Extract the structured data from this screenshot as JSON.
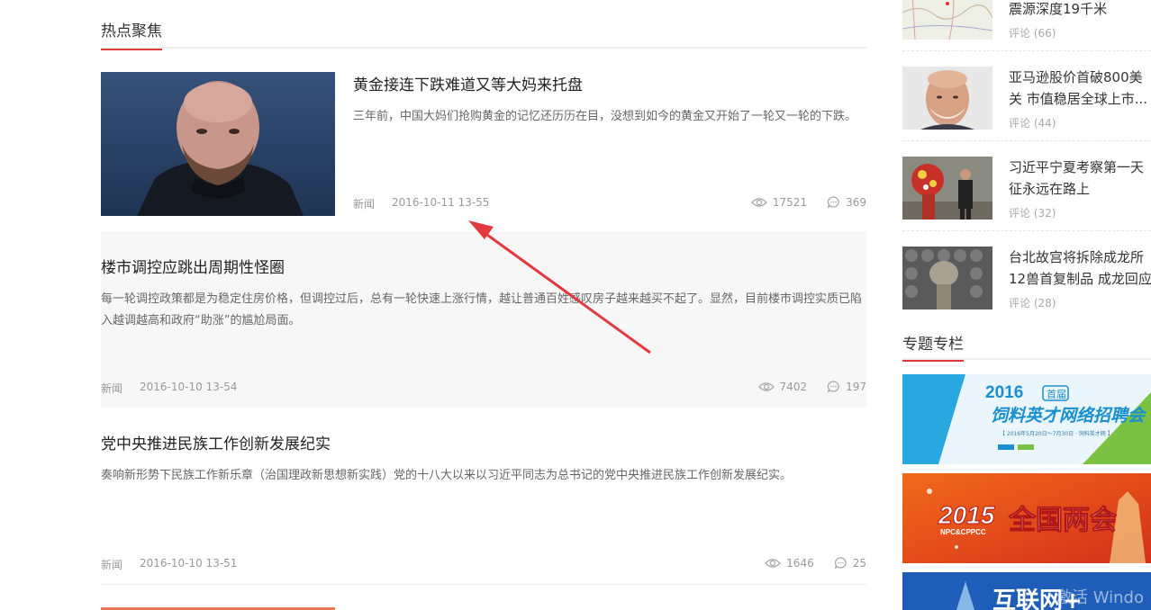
{
  "section_title": "热点聚焦",
  "articles": [
    {
      "title": "黄金接连下跌难道又等大妈来托盘",
      "desc": "三年前，中国大妈们抢购黄金的记忆还历历在目，没想到如今的黄金又开始了一轮又一轮的下跌。",
      "category": "新闻",
      "date": "2016-10-11 13-55",
      "views": "17521",
      "comments": "369"
    },
    {
      "title": "楼市调控应跳出周期性怪圈",
      "desc": "每一轮调控政策都是为稳定住房价格，但调控过后，总有一轮快速上涨行情，越让普通百姓感叹房子越来越买不起了。显然，目前楼市调控实质已陷入越调越高和政府“助涨”的尴尬局面。",
      "category": "新闻",
      "date": "2016-10-10 13-54",
      "views": "7402",
      "comments": "197"
    },
    {
      "title": "党中央推进民族工作创新发展纪实",
      "desc": "奏响新形势下民族工作新乐章（治国理政新思想新实践）党的十八大以来以习近平同志为总书记的党中央推进民族工作创新发展纪实。",
      "category": "新闻",
      "date": "2016-10-10 13-51",
      "views": "1646",
      "comments": "25"
    }
  ],
  "sidebar": {
    "hot": [
      {
        "line1": "",
        "line2": "震源深度19千米",
        "comments": "评论 (66)"
      },
      {
        "line1": "亚马逊股价首破800美",
        "line2": "关 市值稳居全球上市...",
        "comments": "评论 (44)"
      },
      {
        "line1": "习近平宁夏考察第一天",
        "line2": "征永远在路上",
        "comments": "评论 (32)"
      },
      {
        "line1": "台北故宫将拆除成龙所",
        "line2": "12兽首复制品 成龙回应",
        "comments": "评论 (28)"
      }
    ],
    "special_title": "专题专栏",
    "banners": [
      {
        "year": "2016",
        "tag": "首届",
        "headline": "饲料英才网络招聘会",
        "sub": "【 2016年5月20日～7月30日 · 饲料英才网 】"
      },
      {
        "year": "2015",
        "sub": "NPC&CPPCC",
        "headline": "全国两会"
      },
      {
        "headline": "互联网+"
      }
    ]
  },
  "watermark": "激活 Windo",
  "colors": {
    "accent": "#e0393e",
    "arrow": "#e0393e"
  }
}
